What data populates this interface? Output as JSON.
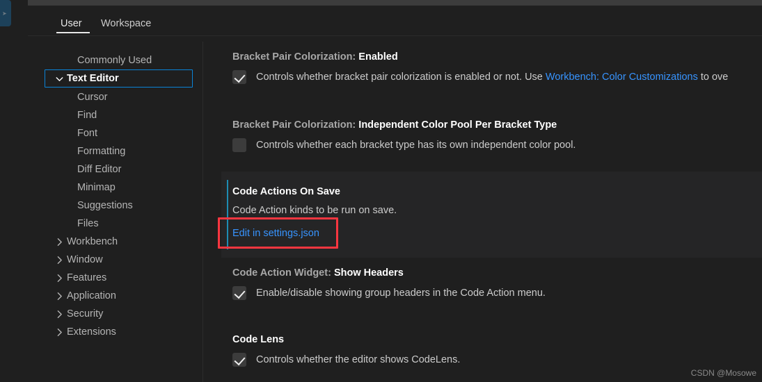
{
  "window": {
    "background": "#1f1f1f",
    "accent_blue": "#0a84d8",
    "link_blue": "#3794ff",
    "modified_bar": "#1d8cb3",
    "annotation_red": "#fb3640"
  },
  "tabs": [
    {
      "label": "User",
      "active": true
    },
    {
      "label": "Workspace",
      "active": false
    }
  ],
  "toc": {
    "items": [
      {
        "label": "Commonly Used",
        "level": 0,
        "arrow": "none",
        "selected": false
      },
      {
        "label": "Text Editor",
        "level": 0,
        "arrow": "down",
        "selected": true
      },
      {
        "label": "Cursor",
        "level": 1,
        "arrow": "none",
        "selected": false
      },
      {
        "label": "Find",
        "level": 1,
        "arrow": "none",
        "selected": false
      },
      {
        "label": "Font",
        "level": 1,
        "arrow": "none",
        "selected": false
      },
      {
        "label": "Formatting",
        "level": 1,
        "arrow": "none",
        "selected": false
      },
      {
        "label": "Diff Editor",
        "level": 1,
        "arrow": "none",
        "selected": false
      },
      {
        "label": "Minimap",
        "level": 1,
        "arrow": "none",
        "selected": false
      },
      {
        "label": "Suggestions",
        "level": 1,
        "arrow": "none",
        "selected": false
      },
      {
        "label": "Files",
        "level": 1,
        "arrow": "none",
        "selected": false
      },
      {
        "label": "Workbench",
        "level": 0,
        "arrow": "right",
        "selected": false
      },
      {
        "label": "Window",
        "level": 0,
        "arrow": "right",
        "selected": false
      },
      {
        "label": "Features",
        "level": 0,
        "arrow": "right",
        "selected": false
      },
      {
        "label": "Application",
        "level": 0,
        "arrow": "right",
        "selected": false
      },
      {
        "label": "Security",
        "level": 0,
        "arrow": "right",
        "selected": false
      },
      {
        "label": "Extensions",
        "level": 0,
        "arrow": "right",
        "selected": false
      }
    ]
  },
  "settings": {
    "bracket_enabled": {
      "category": "Bracket Pair Colorization: ",
      "name": "Enabled",
      "desc_before": "Controls whether bracket pair colorization is enabled or not. Use ",
      "desc_link": "Workbench: Color Customizations",
      "desc_after": " to ove",
      "checked": true
    },
    "bracket_independent_pool": {
      "category": "Bracket Pair Colorization: ",
      "name": "Independent Color Pool Per Bracket Type",
      "desc": "Controls whether each bracket type has its own independent color pool.",
      "checked": false
    },
    "code_actions_on_save": {
      "category": "",
      "name": "Code Actions On Save",
      "desc": "Code Action kinds to be run on save.",
      "edit_link": "Edit in settings.json",
      "modified": true
    },
    "code_action_widget_show_headers": {
      "category": "Code Action Widget: ",
      "name": "Show Headers",
      "desc": "Enable/disable showing group headers in the Code Action menu.",
      "checked": true
    },
    "code_lens": {
      "category": "",
      "name": "Code Lens",
      "desc": "Controls whether the editor shows CodeLens.",
      "checked": true
    }
  },
  "watermark": {
    "text": "CSDN @Mosowe"
  }
}
